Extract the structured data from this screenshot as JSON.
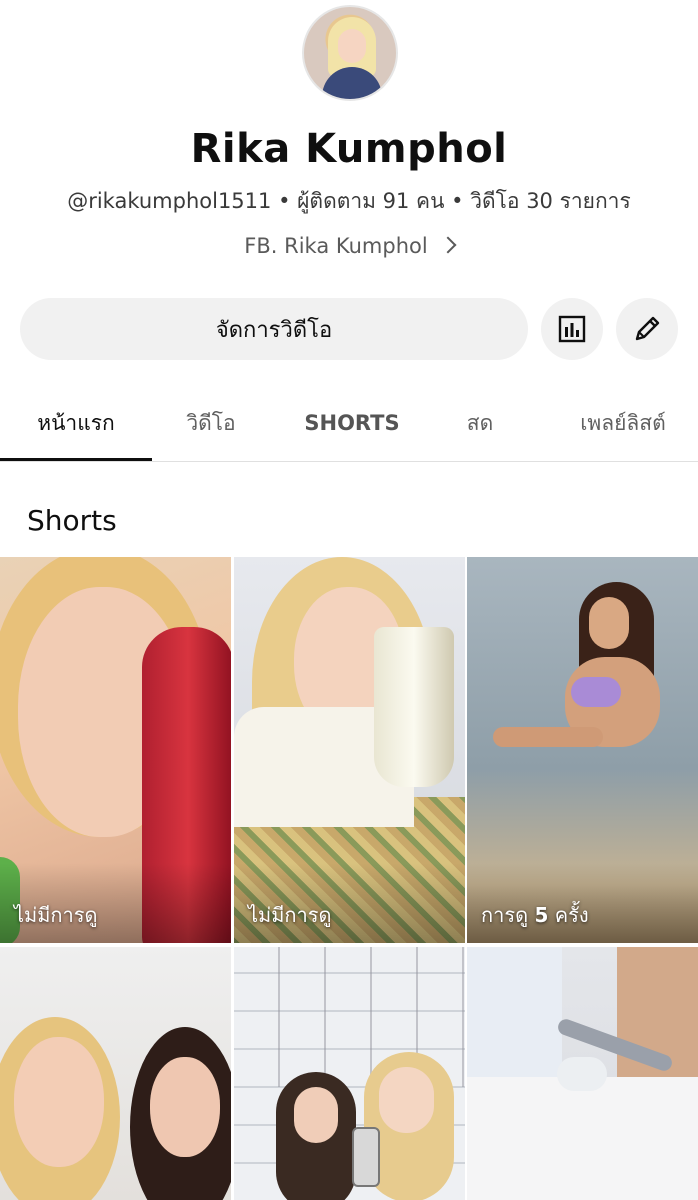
{
  "channel": {
    "name": "Rika Kumphol",
    "meta": "@rikakumphol1511 • ผู้ติดตาม 91 คน • วิดีโอ 30 รายการ",
    "link": "FB. Rika Kumphol"
  },
  "actions": {
    "manage_label": "จัดการวิดีโอ",
    "stats_icon": "bar-chart-icon",
    "edit_icon": "pencil-icon"
  },
  "tabs": [
    {
      "label": "หน้าแรก",
      "active": true
    },
    {
      "label": "วิดีโอ",
      "active": false
    },
    {
      "label": "SHORTS",
      "active": false
    },
    {
      "label": "สด",
      "active": false
    },
    {
      "label": "เพลย์ลิสต์",
      "active": false
    }
  ],
  "section": {
    "title": "Shorts"
  },
  "shorts": [
    {
      "views": "ไม่มีการดู"
    },
    {
      "views": "ไม่มีการดู"
    },
    {
      "views_prefix": "การดู ",
      "views_count": "5",
      "views_suffix": " ครั้ง"
    },
    {},
    {},
    {}
  ],
  "colors": {
    "background": "#ffffff",
    "button_bg": "#f1f1f1",
    "text_primary": "#0f0f0f",
    "text_secondary": "#606060"
  }
}
